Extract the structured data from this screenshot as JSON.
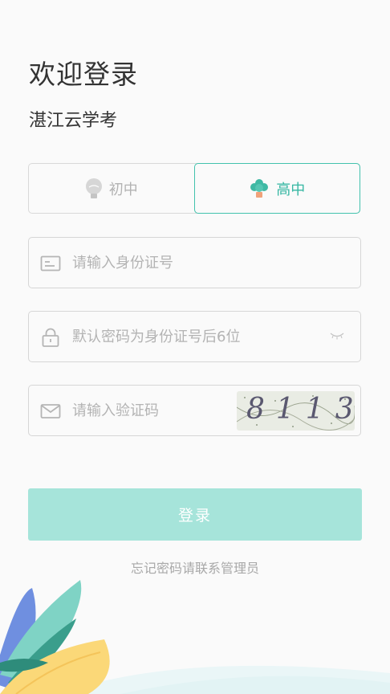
{
  "header": {
    "welcome": "欢迎登录",
    "subtitle": "湛江云学考"
  },
  "level_tabs": [
    {
      "label": "初中",
      "selected": false
    },
    {
      "label": "高中",
      "selected": true
    }
  ],
  "fields": {
    "id_card": {
      "placeholder": "请输入身份证号",
      "value": ""
    },
    "password": {
      "placeholder": "默认密码为身份证号后6位",
      "value": ""
    },
    "captcha": {
      "placeholder": "请输入验证码",
      "value": "",
      "image_text": "8113"
    }
  },
  "login_button": "登录",
  "forgot_text": "忘记密码请联系管理员",
  "colors": {
    "accent": "#42c2ad",
    "button_disabled": "#a6e4da",
    "placeholder": "#b3b3b3"
  }
}
